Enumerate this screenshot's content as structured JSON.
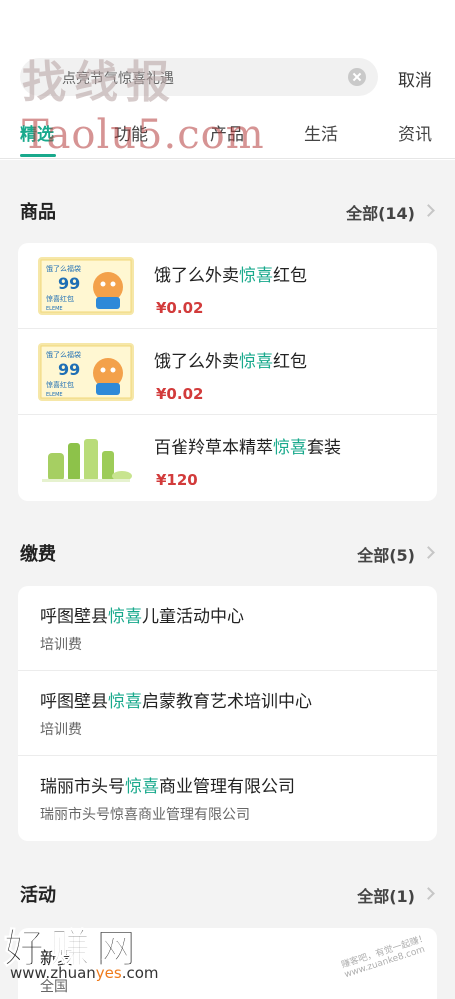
{
  "search": {
    "value": "点亮节气惊喜礼遇",
    "cancel_label": "取消"
  },
  "tabs": [
    {
      "label": "精选",
      "active": true
    },
    {
      "label": "功能",
      "active": false
    },
    {
      "label": "产品",
      "active": false
    },
    {
      "label": "生活",
      "active": false
    },
    {
      "label": "资讯",
      "active": false
    }
  ],
  "highlight_color": "#19a98c",
  "price_color": "#d23b3b",
  "goods": {
    "title": "商品",
    "more": "全部(14)",
    "items": [
      {
        "pre": "饿了么外卖",
        "hl": "惊喜",
        "post": "红包",
        "price": "¥0.02",
        "image": "eleme-coupon-image",
        "img_text": {
          "line1": "饿了么福袋",
          "big": "99",
          "line2": "惊喜红包",
          "brand": "ELEME"
        }
      },
      {
        "pre": "饿了么外卖",
        "hl": "惊喜",
        "post": "红包",
        "price": "¥0.02",
        "image": "eleme-coupon-image",
        "img_text": {
          "line1": "饿了么福袋",
          "big": "99",
          "line2": "惊喜红包",
          "brand": "ELEME"
        }
      },
      {
        "pre": "百雀羚草本精萃",
        "hl": "惊喜",
        "post": "套装",
        "price": "¥120",
        "image": "skincare-set-image"
      }
    ]
  },
  "payments": {
    "title": "缴费",
    "more": "全部(5)",
    "items": [
      {
        "pre": "呼图壁县",
        "hl": "惊喜",
        "post": "儿童活动中心",
        "sub": "培训费"
      },
      {
        "pre": "呼图壁县",
        "hl": "惊喜",
        "post": "启蒙教育艺术培训中心",
        "sub": "培训费"
      },
      {
        "pre": "瑞丽市头号",
        "hl": "惊喜",
        "post": "商业管理有限公司",
        "sub": "瑞丽市头号惊喜商业管理有限公司"
      }
    ]
  },
  "activities": {
    "title": "活动",
    "more": "全部(1)",
    "items": [
      {
        "title": "新夏",
        "sub": "全国"
      }
    ]
  },
  "watermarks": {
    "top": "找线报",
    "middle": "Taolu5.com",
    "bottom": "好赚网",
    "bottom_url_pre": "www.zhuan",
    "bottom_url_hot": "yes",
    "bottom_url_post": ".com",
    "stamp": "赚客吧，有觉一起赚！ www.zuanke8.com"
  }
}
